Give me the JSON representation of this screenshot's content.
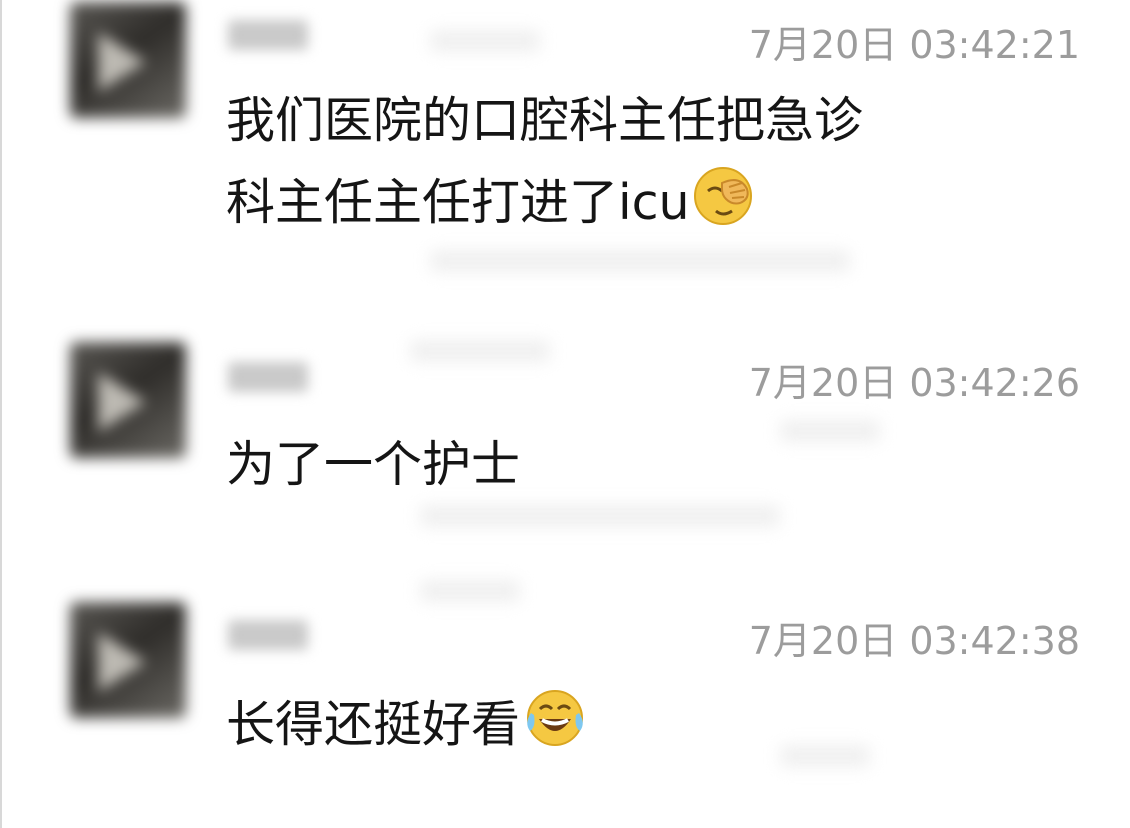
{
  "messages": [
    {
      "timestamp": "7月20日 03:42:21",
      "lines": [
        "我们医院的口腔科主任把急诊",
        "科主任主任打进了icu"
      ],
      "emoji": "facepalm-emoji"
    },
    {
      "timestamp": "7月20日 03:42:26",
      "lines": [
        "为了一个护士"
      ],
      "emoji": ""
    },
    {
      "timestamp": "7月20日 03:42:38",
      "lines": [
        "长得还挺好看"
      ],
      "emoji": "tears-of-joy-emoji"
    }
  ],
  "colors": {
    "background": "#ffffff",
    "text": "#151515",
    "timestamp": "#9c9c9c",
    "emoji_face": "#f5c842"
  }
}
